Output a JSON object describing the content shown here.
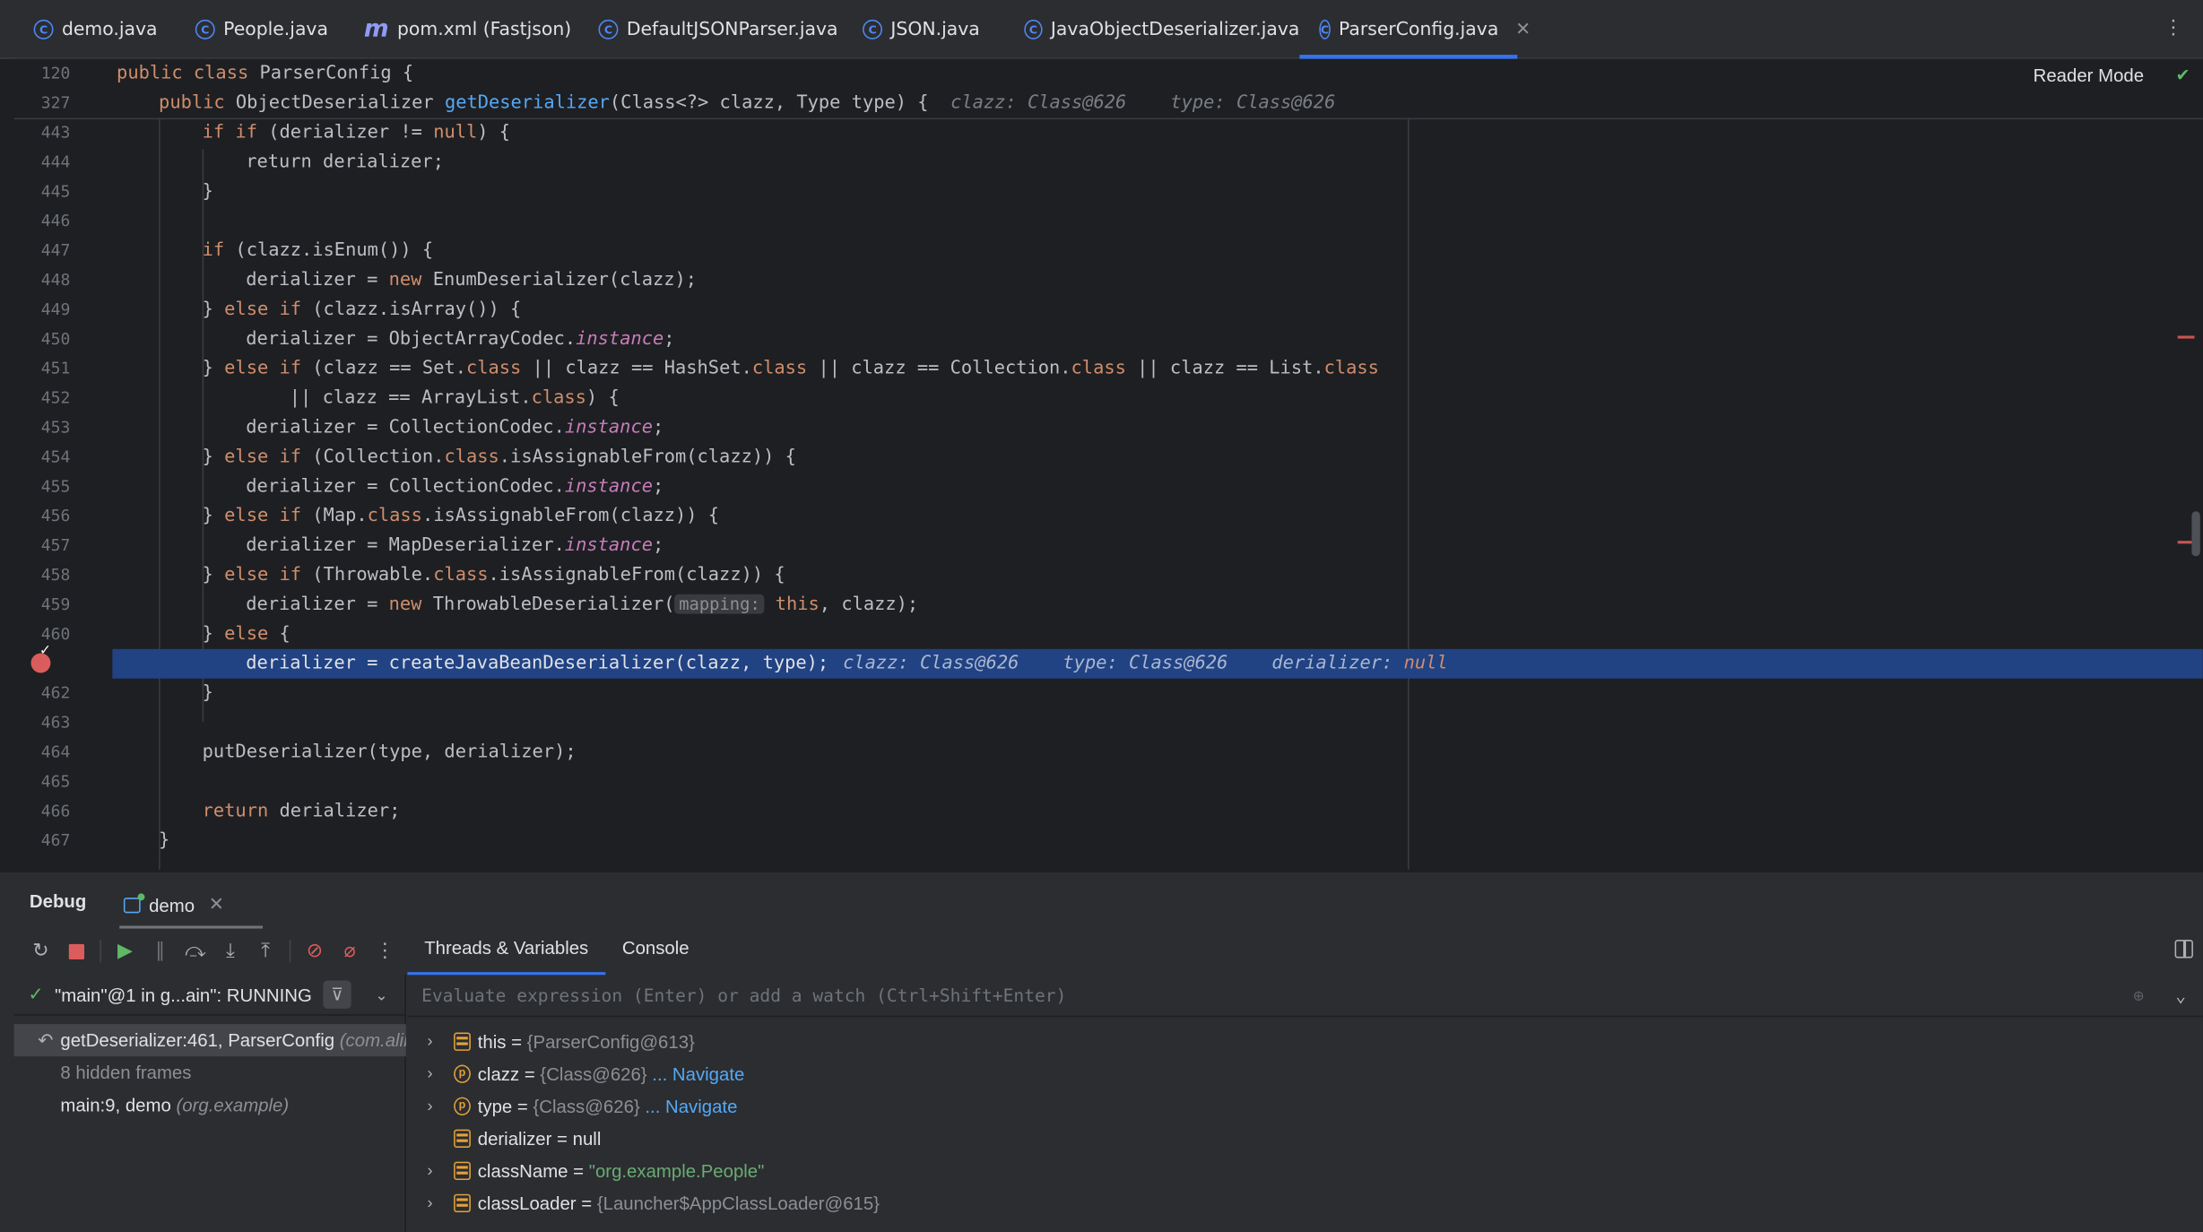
{
  "tabs": [
    {
      "label": "demo.java",
      "icon": "class-icon"
    },
    {
      "label": "People.java",
      "icon": "class-icon"
    },
    {
      "label": "pom.xml (Fastjson)",
      "icon": "maven-icon"
    },
    {
      "label": "DefaultJSONParser.java",
      "icon": "class-icon"
    },
    {
      "label": "JSON.java",
      "icon": "class-icon"
    },
    {
      "label": "JavaObjectDeserializer.java",
      "icon": "class-icon"
    },
    {
      "label": "ParserConfig.java",
      "icon": "class-icon",
      "active": true
    }
  ],
  "editor": {
    "reader_mode": "Reader Mode",
    "sticky": [
      {
        "ln": "120",
        "text": "public class ParserConfig {"
      },
      {
        "ln": "327",
        "text": "public ObjectDeserializer getDeserializer(Class<?> clazz, Type type) {",
        "hint": "clazz: Class@626    type: Class@626"
      }
    ],
    "lines": [
      {
        "ln": "443"
      },
      {
        "ln": "444"
      },
      {
        "ln": "445"
      },
      {
        "ln": "446"
      },
      {
        "ln": "447"
      },
      {
        "ln": "448"
      },
      {
        "ln": "449"
      },
      {
        "ln": "450"
      },
      {
        "ln": "451"
      },
      {
        "ln": "452"
      },
      {
        "ln": "453"
      },
      {
        "ln": "454"
      },
      {
        "ln": "455"
      },
      {
        "ln": "456"
      },
      {
        "ln": "457"
      },
      {
        "ln": "458"
      },
      {
        "ln": "459"
      },
      {
        "ln": "460"
      },
      {
        "ln": ""
      },
      {
        "ln": "462"
      },
      {
        "ln": "463"
      },
      {
        "ln": "464"
      },
      {
        "ln": "465"
      },
      {
        "ln": "466"
      },
      {
        "ln": "467"
      }
    ],
    "code": {
      "l443": "if (derializer != null) {",
      "l444": "return derializer;",
      "l445": "}",
      "l447": "if (clazz.isEnum()) {",
      "l448a": "derializer = ",
      "l448b": "new",
      "l448c": " EnumDeserializer(clazz);",
      "l449": "} else if (clazz.isArray()) {",
      "l450a": "derializer = ObjectArrayCodec.",
      "instance": "instance",
      "semi": ";",
      "l451": "} else if (clazz == Set.class || clazz == HashSet.class || clazz == Collection.class || clazz == List.class",
      "l452": "|| clazz == ArrayList.class) {",
      "l453a": "derializer = CollectionCodec.",
      "l454": "} else if (Collection.class.isAssignableFrom(clazz)) {",
      "l455a": "derializer = CollectionCodec.",
      "l456": "} else if (Map.class.isAssignableFrom(clazz)) {",
      "l457a": "derializer = MapDeserializer.",
      "l458": "} else if (Throwable.class.isAssignableFrom(clazz)) {",
      "l459a": "derializer = ",
      "l459b": "new",
      "l459c": " ThrowableDeserializer(",
      "l459pill": "mapping:",
      "l459d": "this",
      "l459e": ", clazz);",
      "l460": "} else {",
      "l461": "derializer = createJavaBeanDeserializer(clazz, type);",
      "l461hint": "clazz: Class@626    type: Class@626    derializer: null",
      "l462": "}",
      "l464": "putDeserializer(type, derializer);",
      "l466a": "return",
      "l466b": " derializer;",
      "l467": "}"
    }
  },
  "debug": {
    "title": "Debug",
    "session": "demo",
    "subtabs": [
      "Threads & Variables",
      "Console"
    ],
    "thread": "\"main\"@1 in g...ain\": RUNNING",
    "frames": [
      {
        "name": "getDeserializer:461, ParserConfig",
        "pkg": "(com.alibaba"
      },
      {
        "name": "8 hidden frames",
        "pkg": ""
      },
      {
        "name": "main:9, demo",
        "pkg": "(org.example)"
      }
    ],
    "eval_placeholder": "Evaluate expression (Enter) or add a watch (Ctrl+Shift+Enter)",
    "variables": [
      {
        "name": "this",
        "eq": " = ",
        "value": "{ParserConfig@613}",
        "nav": "",
        "type": "field",
        "expandable": true
      },
      {
        "name": "clazz",
        "eq": " = ",
        "value": "{Class@626}",
        "nav": "... Navigate",
        "type": "param",
        "expandable": true
      },
      {
        "name": "type",
        "eq": " = ",
        "value": "{Class@626}",
        "nav": "... Navigate",
        "type": "param",
        "expandable": true
      },
      {
        "name": "derializer",
        "eq": " = ",
        "value": "null",
        "nav": "",
        "type": "field",
        "expandable": false
      },
      {
        "name": "className",
        "eq": " = ",
        "value": "\"org.example.People\"",
        "nav": "",
        "type": "field",
        "expandable": true
      },
      {
        "name": "classLoader",
        "eq": " = ",
        "value": "{Launcher$AppClassLoader@615}",
        "nav": "",
        "type": "field",
        "expandable": true
      }
    ]
  },
  "colors": {
    "accent": "#3574f0",
    "highlight": "#214283",
    "breakpoint": "#db5c5c"
  }
}
